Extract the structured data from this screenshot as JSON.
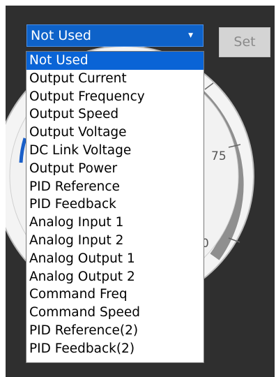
{
  "colors": {
    "panel_bg": "#2f2f2f",
    "selection_blue": "#0a64d6",
    "gauge_face": "#f2f2f2",
    "gauge_band": "#8f8f8f"
  },
  "selector": {
    "value": "Not Used",
    "arrow_icon": "caret-down-icon"
  },
  "set_button": {
    "label": "Set"
  },
  "gauge": {
    "tick_75": "75",
    "tick_partial": "0"
  },
  "options": [
    "Not Used",
    "Output Current",
    "Output Frequency",
    "Output Speed",
    "Output Voltage",
    "DC Link Voltage",
    "Output Power",
    "PID Reference",
    "PID Feedback",
    "Analog Input 1",
    "Analog Input 2",
    "Analog Output 1",
    "Analog Output 2",
    "Command Freq",
    "Command Speed",
    "PID Reference(2)",
    "PID Feedback(2)"
  ],
  "selected_index": 0
}
